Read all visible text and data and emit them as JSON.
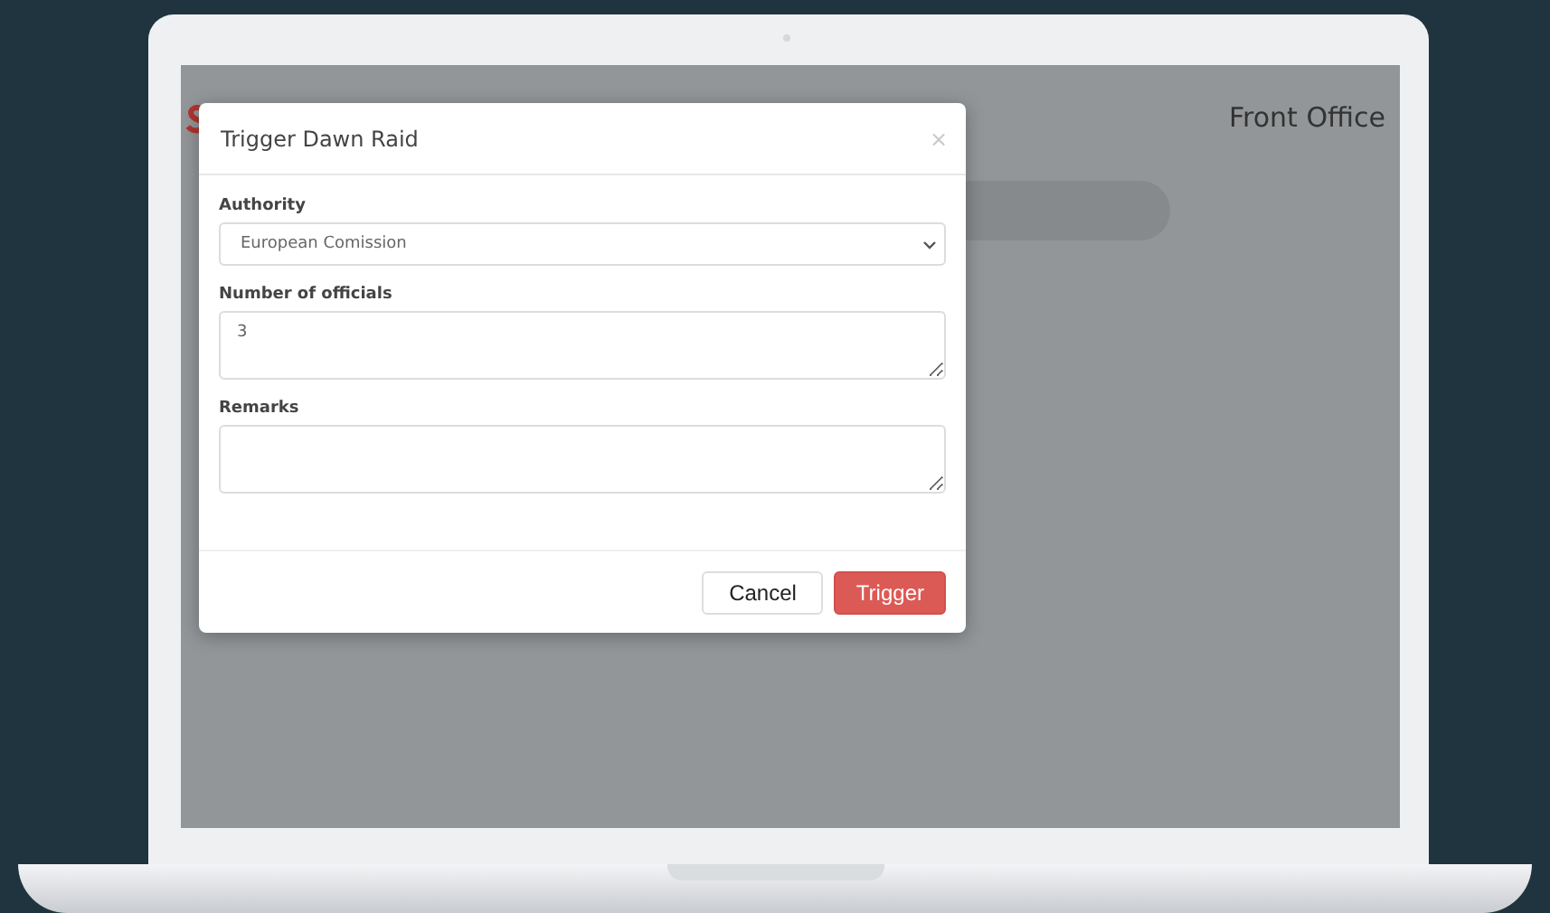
{
  "header": {
    "title": "Front Office"
  },
  "modal": {
    "title": "Trigger Dawn Raid",
    "close": "×",
    "fields": [
      {
        "kind": "select",
        "label": "Authority",
        "value": "European Comission"
      },
      {
        "kind": "textarea",
        "label": "Number of officials",
        "value": "3"
      },
      {
        "kind": "textarea",
        "label": "Remarks"
      }
    ],
    "buttons": [
      {
        "kind": "secondary",
        "label": "Cancel"
      },
      {
        "kind": "primary",
        "label": "Trigger"
      }
    ]
  }
}
